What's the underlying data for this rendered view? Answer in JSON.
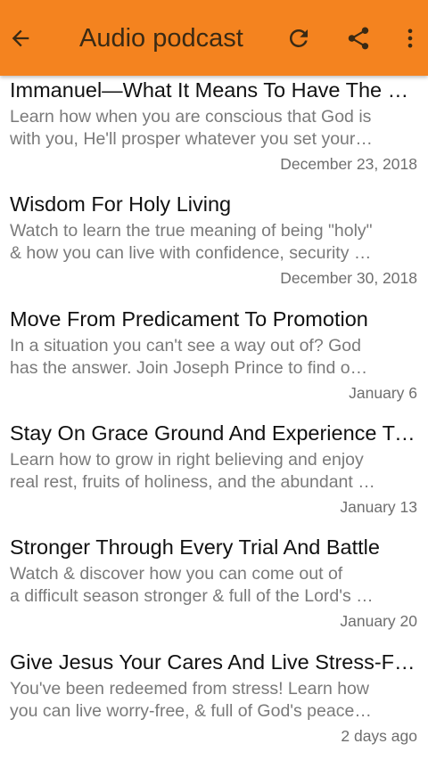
{
  "appbar": {
    "title": "Audio podcast",
    "back_icon": "arrow-left-icon",
    "refresh_icon": "refresh-icon",
    "share_icon": "share-icon",
    "more_icon": "more-vert-icon",
    "background_color": "#f4831f"
  },
  "items": [
    {
      "title": "Immanuel—What It Means To Have The Lord…",
      "desc_line1": "Learn how when you are conscious that God is",
      "desc_line2": "with you, He'll prosper whatever you set your …",
      "date": "December 23, 2018"
    },
    {
      "title": "Wisdom For Holy Living",
      "desc_line1": "Watch to learn the true meaning of being \"holy\"",
      "desc_line2": "& how you can live with confidence, security &…",
      "date": "December 30, 2018"
    },
    {
      "title": "Move From Predicament To Promotion",
      "desc_line1": "In a situation you can't see a way out of? God",
      "desc_line2": "has the answer. Join Joseph Prince to find ou…",
      "date": "January 6"
    },
    {
      "title": "Stay On Grace Ground And Experience True…",
      "desc_line1": "Learn how to grow in right believing and enjoy",
      "desc_line2": "real rest, fruits of holiness, and the abundant li…",
      "date": "January 13"
    },
    {
      "title": "Stronger Through Every Trial And Battle",
      "desc_line1": "Watch & discover how you can come out of",
      "desc_line2": "a difficult season stronger & full of the Lord's …",
      "date": "January 20"
    },
    {
      "title": "Give Jesus Your Cares And Live Stress-Free…",
      "desc_line1": "You've been redeemed from stress! Learn how",
      "desc_line2": "you can live worry-free, & full of God's peace &…",
      "date": "2 days ago"
    }
  ]
}
